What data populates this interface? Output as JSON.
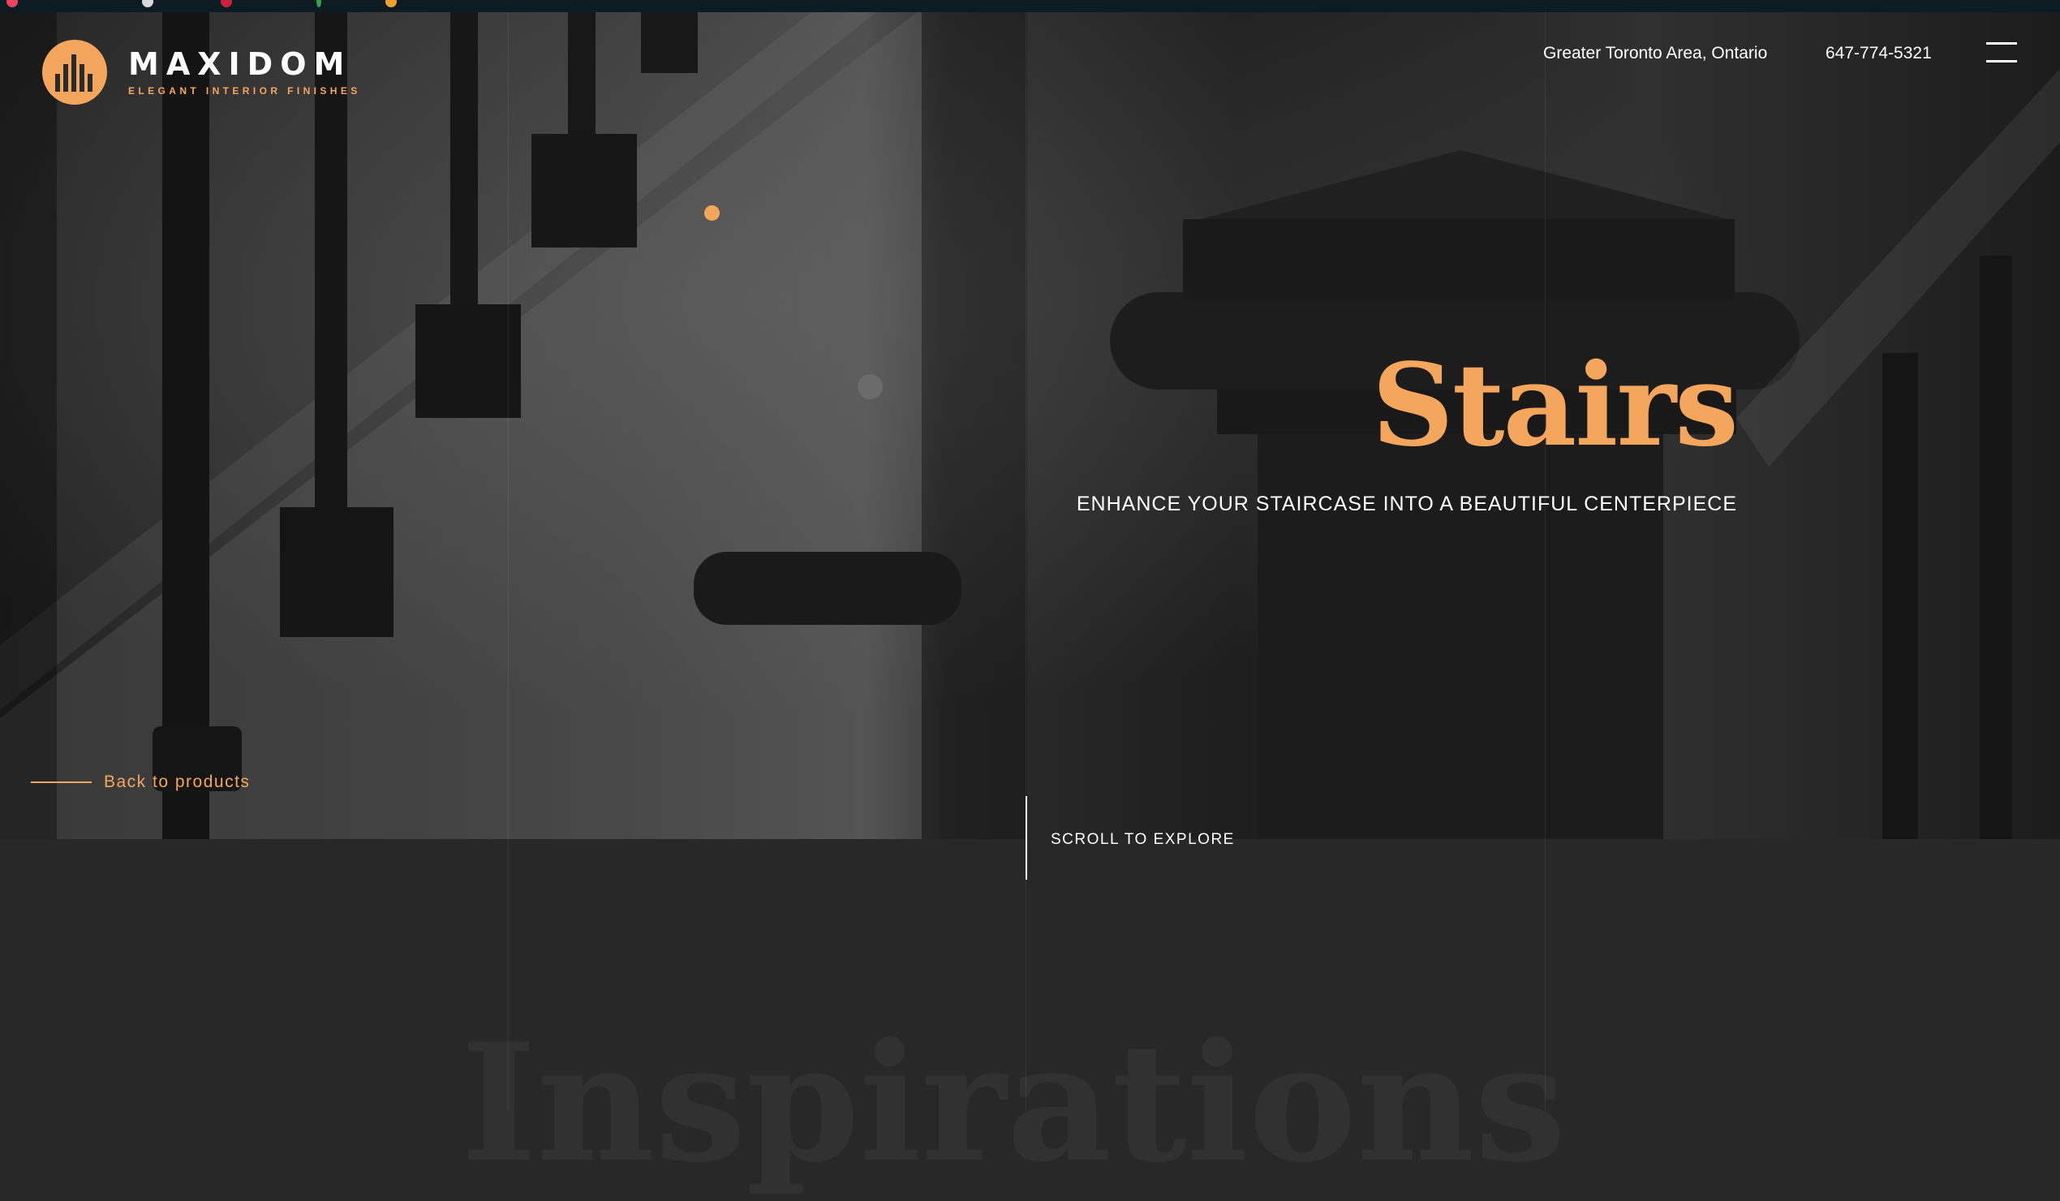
{
  "brand": {
    "name": "MAXIDOM",
    "tagline": "ELEGANT INTERIOR FINISHES",
    "accent_color": "#f4a75c"
  },
  "header": {
    "location": "Greater Toronto Area, Ontario",
    "phone": "647-774-5321",
    "menu_icon": "hamburger-menu-icon"
  },
  "hero": {
    "title": "Stairs",
    "subtitle": "ENHANCE YOUR STAIRCASE INTO A BEAUTIFUL CENTERPIECE",
    "back_link": "Back to products",
    "scroll_hint": "SCROLL TO EXPLORE"
  },
  "section": {
    "watermark_title": "Inspirations"
  }
}
